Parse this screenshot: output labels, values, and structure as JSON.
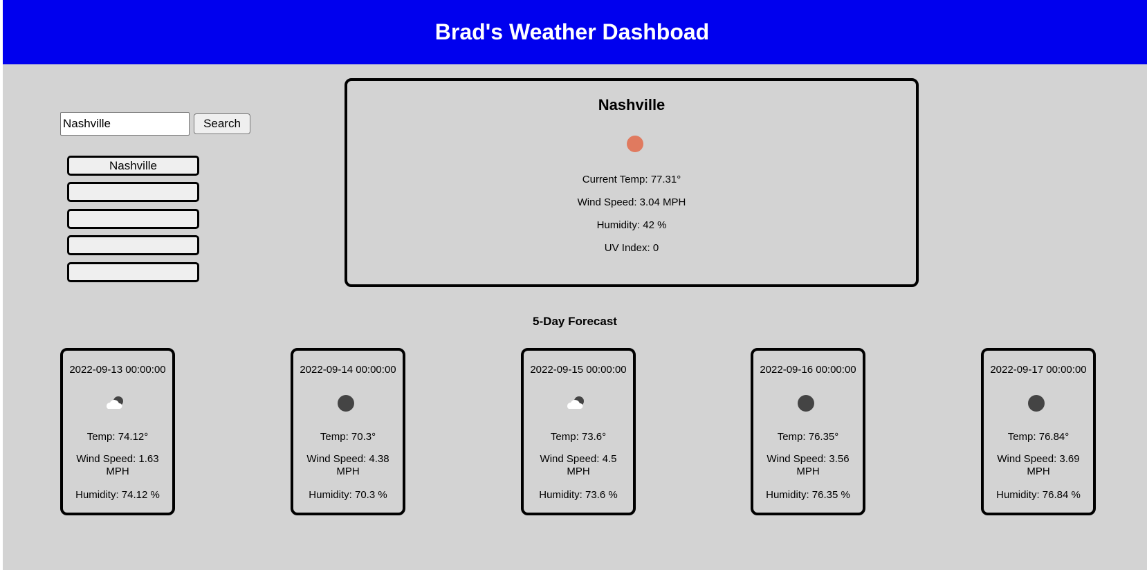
{
  "header": {
    "title": "Brad's Weather Dashboad"
  },
  "search": {
    "value": "Nashville",
    "button_label": "Search"
  },
  "history": [
    "Nashville",
    "",
    "",
    "",
    ""
  ],
  "current": {
    "city": "Nashville",
    "icon": "sun-icon",
    "icon_color": "#e07a5f",
    "temp": "Current Temp: 77.31°",
    "wind": "Wind Speed: 3.04 MPH",
    "humidity": "Humidity: 42 %",
    "uv": "UV Index: 0"
  },
  "forecast": {
    "title": "5-Day Forecast",
    "days": [
      {
        "date": "2022-09-13 00:00:00",
        "icon": "partly-cloudy-night-icon",
        "temp": "Temp: 74.12°",
        "wind": "Wind Speed: 1.63 MPH",
        "humidity": "Humidity: 74.12 %"
      },
      {
        "date": "2022-09-14 00:00:00",
        "icon": "moon-icon",
        "temp": "Temp: 70.3°",
        "wind": "Wind Speed: 4.38 MPH",
        "humidity": "Humidity: 70.3 %"
      },
      {
        "date": "2022-09-15 00:00:00",
        "icon": "partly-cloudy-night-icon",
        "temp": "Temp: 73.6°",
        "wind": "Wind Speed: 4.5 MPH",
        "humidity": "Humidity: 73.6 %"
      },
      {
        "date": "2022-09-16 00:00:00",
        "icon": "moon-icon",
        "temp": "Temp: 76.35°",
        "wind": "Wind Speed: 3.56 MPH",
        "humidity": "Humidity: 76.35 %"
      },
      {
        "date": "2022-09-17 00:00:00",
        "icon": "moon-icon",
        "temp": "Temp: 76.84°",
        "wind": "Wind Speed: 3.69 MPH",
        "humidity": "Humidity: 76.84 %"
      }
    ]
  },
  "colors": {
    "header_bg": "#0000ee",
    "page_bg": "#d3d3d3",
    "moon": "#444444"
  }
}
